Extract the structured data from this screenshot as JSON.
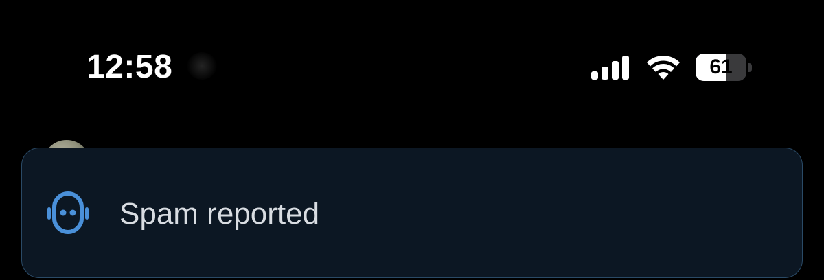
{
  "status_bar": {
    "time": "12:58",
    "battery_level": "61",
    "battery_percent": 61,
    "icons": [
      "signal-icon",
      "wifi-icon",
      "battery-icon"
    ]
  },
  "toast": {
    "message": "Spam reported",
    "icon": "robot-icon",
    "accent_color": "#4a90d9",
    "background_color": "#0c1723",
    "border_color": "#2a4a66"
  }
}
